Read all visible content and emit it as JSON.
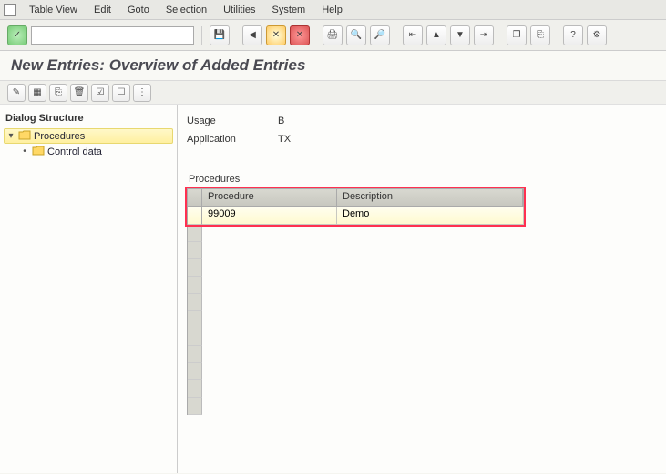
{
  "menu": {
    "items": [
      "Table View",
      "Edit",
      "Goto",
      "Selection",
      "Utilities",
      "System",
      "Help"
    ]
  },
  "title": "New Entries: Overview of Added Entries",
  "sidebar": {
    "heading": "Dialog Structure",
    "nodes": [
      {
        "label": "Procedures",
        "selected": true,
        "expanded": true
      },
      {
        "label": "Control data",
        "selected": false
      }
    ]
  },
  "meta": {
    "usage_label": "Usage",
    "usage_value": "B",
    "application_label": "Application",
    "application_value": "TX"
  },
  "table": {
    "section_label": "Procedures",
    "col_procedure": "Procedure",
    "col_description": "Description",
    "rows": [
      {
        "procedure": "99009",
        "description": "Demo"
      }
    ]
  }
}
